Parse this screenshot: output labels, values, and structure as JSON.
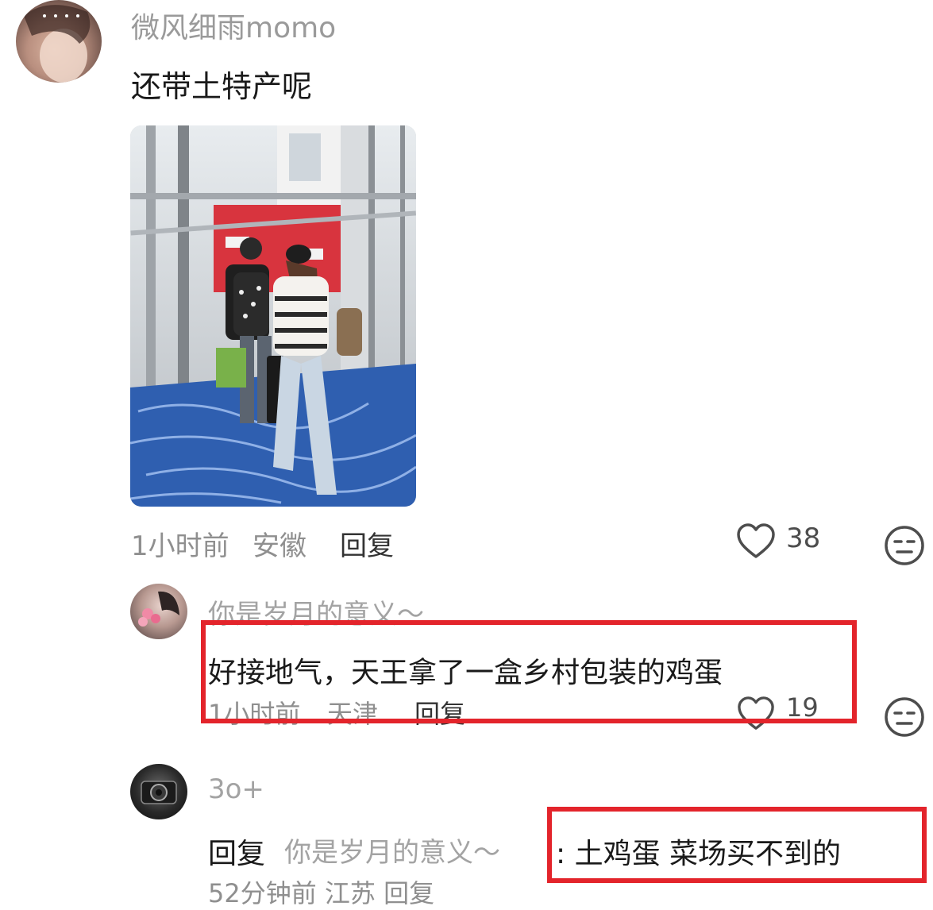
{
  "comment_main": {
    "username": "微风细雨momo",
    "text": "还带土特产呢",
    "time": "1小时前",
    "location": "安徽",
    "reply_label": "回复",
    "like_count": "38",
    "icons": [
      "heart-icon",
      "emoji-icon"
    ]
  },
  "reply_1": {
    "username": "你是岁月的意义～",
    "text": "好接地气，天王拿了一盒乡村包装的鸡蛋",
    "time": "1小时前",
    "location": "天津",
    "reply_label": "回复",
    "like_count": "19",
    "icons": [
      "heart-icon",
      "emoji-icon"
    ]
  },
  "reply_2": {
    "username": "3o+",
    "reply_prefix": "回复",
    "reply_target": "你是岁月的意义～",
    "text": ": 土鸡蛋 菜场买不到的",
    "partial_meta": "52分钟前 江苏 回复"
  },
  "colors": {
    "highlight_border": "#e3242b",
    "carpet_blue": "#2f5fb0",
    "sign_red": "#d8343e"
  }
}
